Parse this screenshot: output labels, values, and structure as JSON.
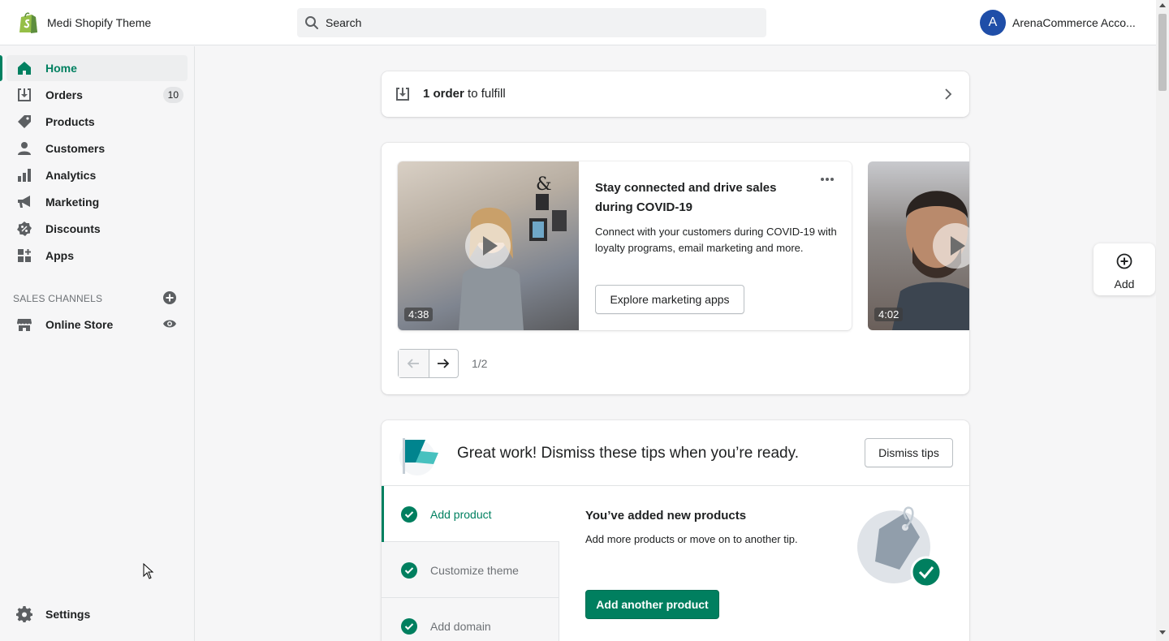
{
  "app": {
    "store_name": "Medi Shopify Theme",
    "account_initial": "A",
    "account_name": "ArenaCommerce Acco...",
    "brand_color": "#008060"
  },
  "search": {
    "placeholder": "Search"
  },
  "sidebar": {
    "items": [
      {
        "label": "Home",
        "icon": "home-icon",
        "active": true
      },
      {
        "label": "Orders",
        "icon": "orders-icon",
        "badge": "10"
      },
      {
        "label": "Products",
        "icon": "tag-icon"
      },
      {
        "label": "Customers",
        "icon": "person-icon"
      },
      {
        "label": "Analytics",
        "icon": "bar-chart-icon"
      },
      {
        "label": "Marketing",
        "icon": "megaphone-icon"
      },
      {
        "label": "Discounts",
        "icon": "discount-icon"
      },
      {
        "label": "Apps",
        "icon": "apps-icon"
      }
    ],
    "sales_channels_heading": "SALES CHANNELS",
    "online_store": "Online Store",
    "settings": "Settings"
  },
  "fulfill": {
    "count": "1 order",
    "rest": " to fulfill"
  },
  "promo": {
    "video1_duration": "4:38",
    "title": "Stay connected and drive sales during COVID-19",
    "body": "Connect with your customers during COVID-19 with loyalty programs, email marketing and more.",
    "button": "Explore marketing apps",
    "video2_duration": "4:02",
    "page": "1/2"
  },
  "add_widget": {
    "label": "Add"
  },
  "tips": {
    "title": "Great work! Dismiss these tips when you’re ready.",
    "dismiss": "Dismiss tips",
    "tabs": [
      "Add product",
      "Customize theme",
      "Add domain"
    ],
    "active_heading": "You’ve added new products",
    "active_body": "Add more products or move on to another tip.",
    "primary_button": "Add another product"
  }
}
